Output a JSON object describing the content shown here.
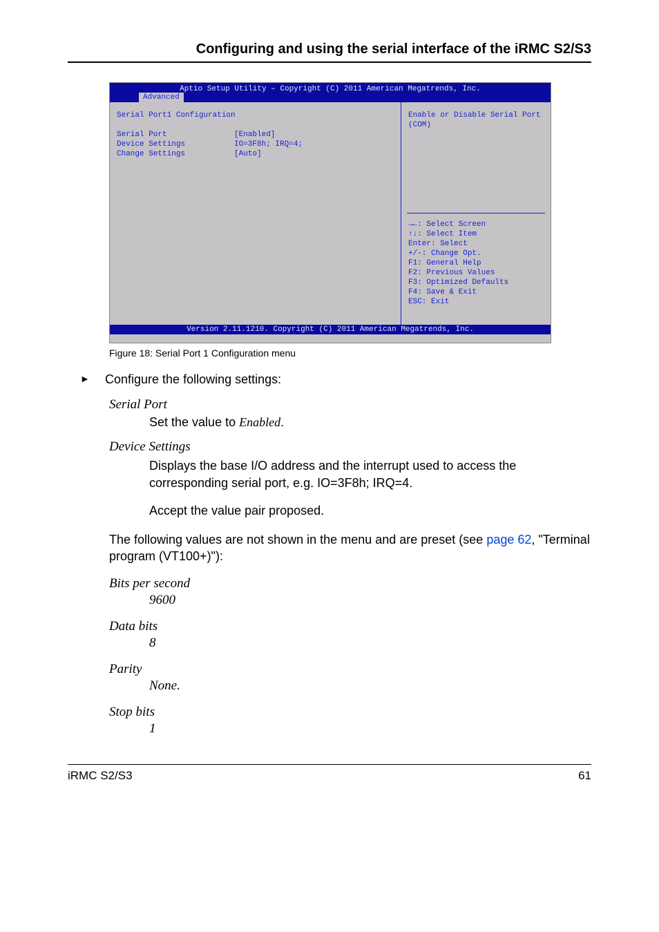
{
  "header": {
    "title": "Configuring and using the serial interface of the iRMC S2/S3"
  },
  "bios": {
    "top_line": "Aptio Setup Utility – Copyright (C) 2011 American Megatrends, Inc.",
    "tab": "Advanced",
    "left": {
      "section_title": "Serial Port1  Configuration",
      "rows": [
        {
          "label": "Serial Port",
          "value": "[Enabled]"
        },
        {
          "label": "Device Settings",
          "value": "IO=3F8h; IRQ=4;"
        },
        {
          "label": "",
          "value": ""
        },
        {
          "label": "Change Settings",
          "value": "[Auto]"
        }
      ]
    },
    "right": {
      "description": "Enable or Disable Serial Port (COM)",
      "help": [
        "→←: Select Screen",
        "↑↓: Select Item",
        "Enter: Select",
        "+/-: Change Opt.",
        "F1: General Help",
        "F2: Previous Values",
        "F3: Optimized Defaults",
        "F4: Save & Exit",
        "ESC: Exit"
      ]
    },
    "footer": "Version 2.11.1210. Copyright (C) 2011 American Megatrends, Inc."
  },
  "figure_caption": "Figure 18: Serial Port 1 Configuration menu",
  "step": {
    "marker": "►",
    "text": "Configure the following settings:"
  },
  "settings": {
    "serial_port": {
      "label": "Serial Port",
      "value_prefix": "Set the value to ",
      "value_ital": "Enabled",
      "value_suffix": "."
    },
    "device_settings": {
      "label": " Device Settings",
      "line1": "Displays the base I/O address and the interrupt used to access the corresponding serial port, e.g. IO=3F8h; IRQ=4.",
      "line2": "Accept the value pair proposed."
    }
  },
  "preset_intro": {
    "part1": "The following values are not shown in the menu and are preset (see ",
    "link": "page 62",
    "part2": ", \"Terminal program (VT100+)\"):"
  },
  "presets": [
    {
      "label": "Bits per second",
      "value": "9600"
    },
    {
      "label": "Data bits",
      "value": "8"
    },
    {
      "label": "Parity",
      "value": "None."
    },
    {
      "label": "Stop bits",
      "value": "1"
    }
  ],
  "footer": {
    "left": "iRMC S2/S3",
    "right": "61"
  }
}
